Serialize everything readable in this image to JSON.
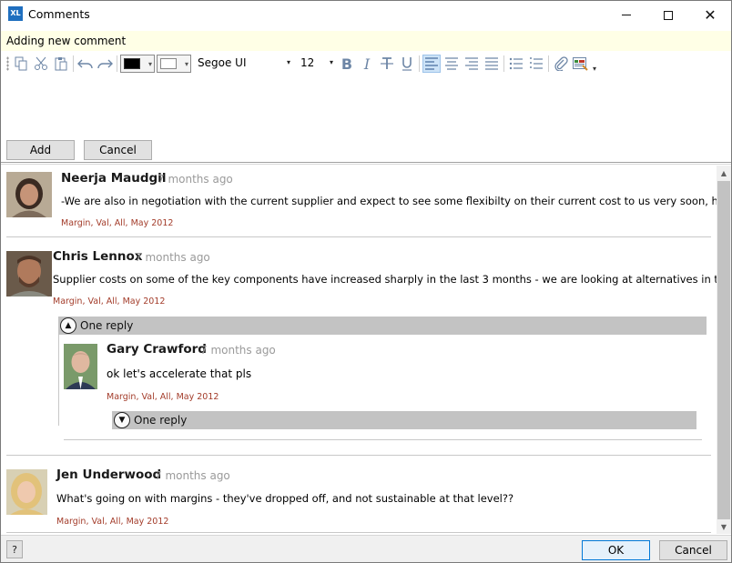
{
  "window": {
    "title": "Comments",
    "app_icon_text": "XL",
    "close_glyph": "✕"
  },
  "status": {
    "text": "Adding new comment"
  },
  "toolbar": {
    "text_color": "#000000",
    "highlight_color": "#ffffff",
    "font_name": "Segoe UI",
    "font_size": "12",
    "combo_arrow": "▾",
    "bold": "B",
    "italic": "I",
    "more": "▾"
  },
  "editor": {
    "add_label": "Add",
    "cancel_label": "Cancel"
  },
  "comments": [
    {
      "author": "Neerja Maudgil",
      "ago": "7 months ago",
      "text": "-We are also in negotiation with the current supplier and expect to see some flexibilty on their current cost to us very soon, hopefully this week.",
      "tags": "Margin, Val, All, May 2012"
    },
    {
      "author": "Chris Lennox",
      "ago": "7 months ago",
      "text": "Supplier costs on some of the key components have increased sharply in the last 3 months - we are looking at alternatives in the medium term",
      "tags": "Margin, Val, All, May 2012",
      "replies_label": "One reply",
      "reply": {
        "author": "Gary Crawford",
        "ago": "7 months ago",
        "text": "ok let's accelerate that pls",
        "tags": "Margin, Val, All, May 2012",
        "replies_label": "One reply"
      }
    },
    {
      "author": "Jen Underwood",
      "ago": "7 months ago",
      "text": "What's going on with margins - they've dropped off, and not sustainable at that level??",
      "tags": "Margin, Val, All, May 2012"
    }
  ],
  "reply_toggle": {
    "expanded_glyph": "▲",
    "collapsed_glyph": "▼"
  },
  "scrollbar": {
    "up": "▲",
    "down": "▼"
  },
  "footer": {
    "help_label": "?",
    "ok_label": "OK",
    "cancel_label": "Cancel"
  }
}
